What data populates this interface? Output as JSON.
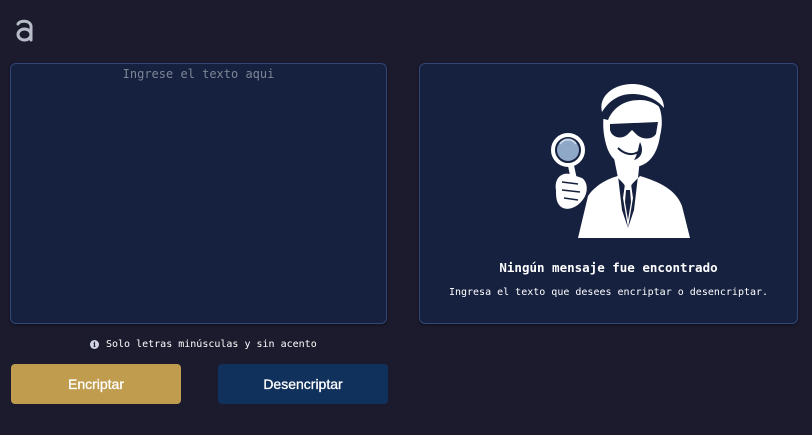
{
  "logo": {
    "icon": "alura-a-logo",
    "color": "#b8bcc8"
  },
  "input": {
    "placeholder": "Ingrese el texto aqui",
    "value": ""
  },
  "output": {
    "illustration": "detective-with-magnifier",
    "title": "Ningún mensaje fue encontrado",
    "text": "Ingresa el texto que desees encriptar o desencriptar."
  },
  "hint": {
    "icon": "info-icon",
    "text": "Solo letras minúsculas y sin acento"
  },
  "buttons": {
    "encrypt_label": "Encriptar",
    "decrypt_label": "Desencriptar"
  },
  "colors": {
    "background": "#1c1b2e",
    "panel": "#16213f",
    "encrypt_button": "#c09c4f",
    "decrypt_button": "#11315d"
  }
}
